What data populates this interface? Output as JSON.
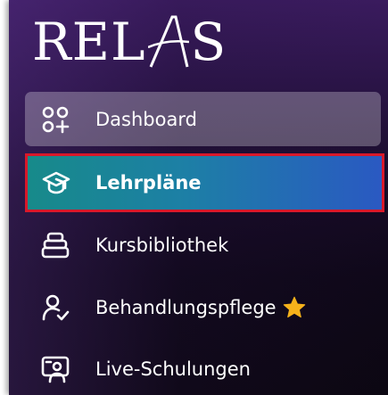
{
  "app": {
    "logo_text_left": "REL",
    "logo_text_right": "S",
    "logo_accent_letter": "A"
  },
  "sidebar": {
    "items": [
      {
        "label": "Dashboard",
        "icon": "dashboard-grid-plus-icon",
        "state": "hover"
      },
      {
        "label": "Lehrpläne",
        "icon": "graduation-cap-icon",
        "state": "active"
      },
      {
        "label": "Kursbibliothek",
        "icon": "library-stack-icon",
        "state": "default"
      },
      {
        "label": "Behandlungspflege",
        "icon": "user-check-icon",
        "state": "default",
        "badge_icon": "star-icon"
      },
      {
        "label": "Live-Schulungen",
        "icon": "presenter-screen-icon",
        "state": "default"
      }
    ]
  },
  "colors": {
    "sidebar_top": "#3a1b5e",
    "sidebar_bottom": "#0c0712",
    "active_gradient_start": "#178a8a",
    "active_gradient_end": "#2a59c2",
    "highlight_border": "#d8182a",
    "star": "#f6b21b"
  }
}
